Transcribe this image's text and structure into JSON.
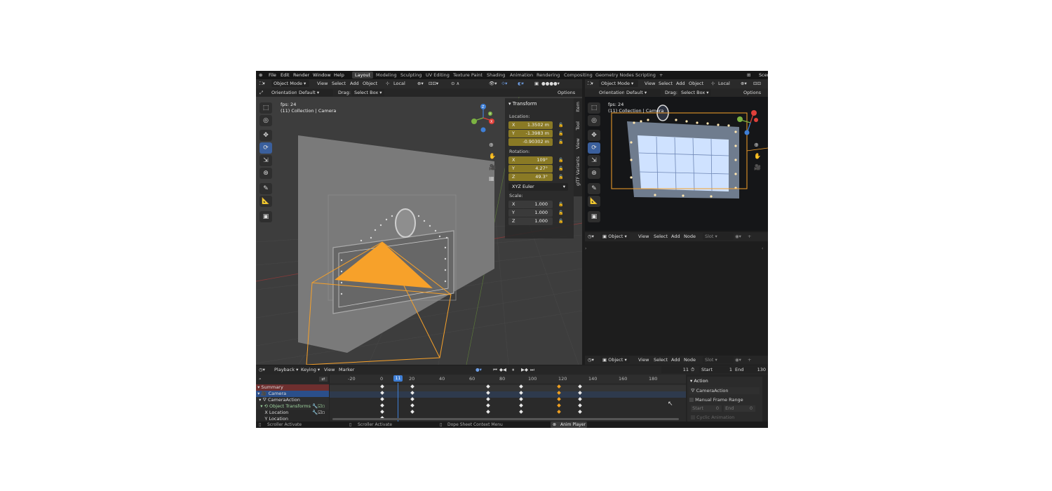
{
  "topbar": {
    "menu": [
      "File",
      "Edit",
      "Render",
      "Window",
      "Help"
    ],
    "workspaces": [
      "Layout",
      "Modeling",
      "Sculpting",
      "UV Editing",
      "Texture Paint",
      "Shading",
      "Animation",
      "Rendering",
      "Compositing",
      "Geometry Nodes",
      "Scripting"
    ],
    "active_workspace": "Layout",
    "add_tab": "+",
    "scene_label": "Scen"
  },
  "viewport": {
    "mode": "Object Mode",
    "menu": [
      "View",
      "Select",
      "Add",
      "Object"
    ],
    "transform_space": "Local",
    "orientation_label": "Orientation:",
    "orientation_value": "Default",
    "drag_label": "Drag:",
    "drag_value": "Select Box",
    "options": "Options",
    "fps": "fps: 24",
    "collection": "(11) Collection | Camera",
    "colors": {
      "camera_orange": "#f7a12a",
      "gizmo_x": "#e0403a",
      "gizmo_y": "#7cb342",
      "gizmo_z": "#3f7fd6"
    }
  },
  "npanel": {
    "title": "Transform",
    "location_label": "Location:",
    "location": [
      {
        "axis": "X",
        "value": "1.3502 m"
      },
      {
        "axis": "Y",
        "value": "-1.3983 m"
      },
      {
        "axis": "",
        "value": "-0.90302 m"
      }
    ],
    "rotation_label": "Rotation:",
    "rotation": [
      {
        "axis": "X",
        "value": "109°"
      },
      {
        "axis": "Y",
        "value": "4.27°"
      },
      {
        "axis": "Z",
        "value": "49.3°"
      }
    ],
    "rotation_mode": "XYZ Euler",
    "scale_label": "Scale:",
    "scale": [
      {
        "axis": "X",
        "value": "1.000"
      },
      {
        "axis": "Y",
        "value": "1.000"
      },
      {
        "axis": "Z",
        "value": "1.000"
      }
    ],
    "tabs": [
      "Item",
      "Tool",
      "View",
      "glTF Variants"
    ]
  },
  "camera_view": {
    "mode": "Object Mode",
    "menu": [
      "View",
      "Select",
      "Add",
      "Object"
    ],
    "transform_space": "Local",
    "orientation_label": "Orientation:",
    "orientation_value": "Default",
    "drag_label": "Drag:",
    "drag_value": "Select Box",
    "options": "Options",
    "fps": "fps: 24",
    "collection": "(11) Collection | Camera"
  },
  "node_editor": {
    "type": "Object",
    "menu": [
      "View",
      "Select",
      "Add",
      "Node"
    ],
    "slot": "Slot"
  },
  "node_editor_bottom": {
    "type": "Object",
    "menu": [
      "View",
      "Select",
      "Add",
      "Node"
    ],
    "slot": "Slot"
  },
  "timeline": {
    "menu": [
      "Playback",
      "Keying",
      "View",
      "Marker"
    ],
    "current_frame": "11",
    "start_label": "Start",
    "start": "1",
    "end_label": "End",
    "end": "130",
    "ruler": [
      "-20",
      "0",
      "20",
      "40",
      "60",
      "80",
      "100",
      "120",
      "140",
      "160",
      "180"
    ],
    "current_marker": "11",
    "channels": [
      "Summary",
      "Camera",
      "CameraAction",
      "Object Transforms",
      "X Location",
      "Y Location"
    ],
    "key_frames": [
      0,
      20,
      70,
      92,
      117,
      131
    ],
    "selected_frame": 117
  },
  "action_panel": {
    "title": "Action",
    "name": "CameraAction",
    "manual_range": "Manual Frame Range",
    "start_label": "Start",
    "start": "0",
    "end_label": "End",
    "end": "0",
    "cyclic": "Cyclic Animation"
  },
  "statusbar": {
    "items": [
      "Scroller Activate",
      "Scroller Activate",
      "Dope Sheet Context Menu",
      "Anim Player"
    ]
  }
}
